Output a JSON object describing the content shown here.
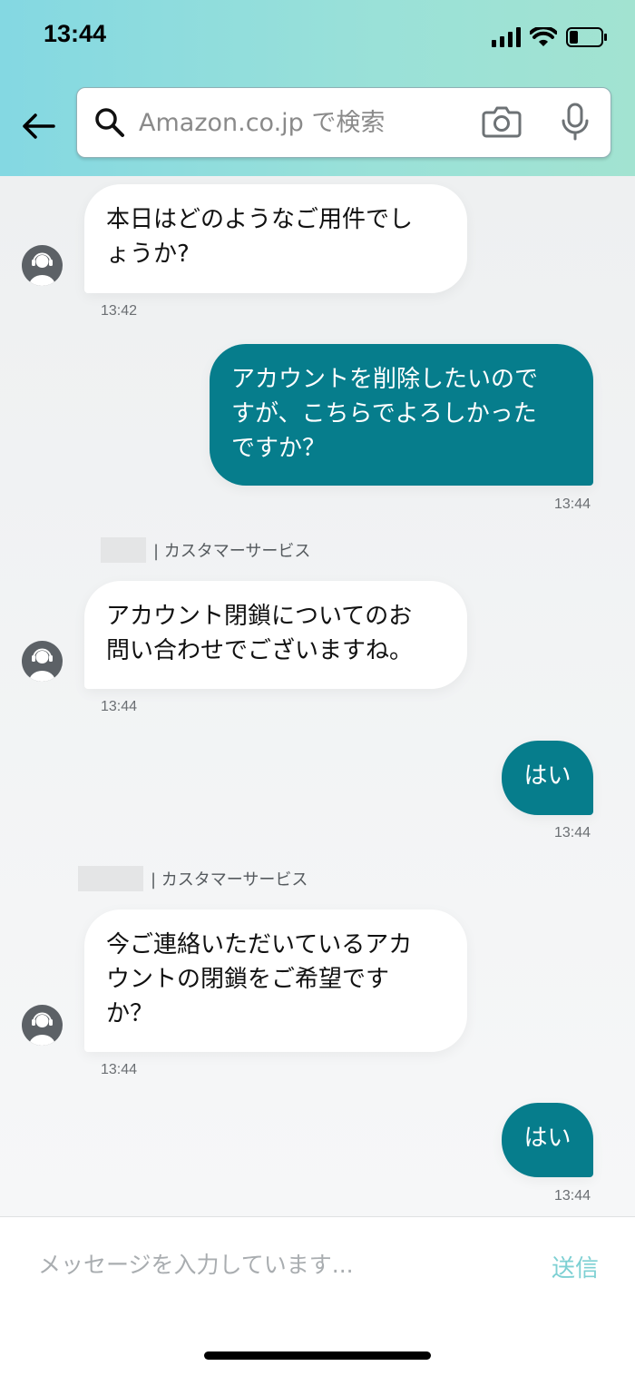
{
  "status_bar": {
    "time": "13:44"
  },
  "search": {
    "placeholder": "Amazon.co.jp で検索"
  },
  "messages": [
    {
      "from": "agent",
      "text": "本日はどのようなご用件でし\nょうか?",
      "time": "13:42"
    },
    {
      "from": "user",
      "text": "アカウントを削除したいので\nすが、こちらでよろしかった\nですか？",
      "time": "13:44"
    },
    {
      "from": "agent",
      "sender": "| カスタマーサービス",
      "text": "アカウント閉鎖についてのお\n問い合わせでございますね。",
      "time": "13:44"
    },
    {
      "from": "user",
      "text": "はい",
      "time": "13:44"
    },
    {
      "from": "agent",
      "sender": "| カスタマーサービス",
      "text": "今ご連絡いただいているアカ\nウントの閉鎖をご希望です\nか？",
      "time": "13:44"
    },
    {
      "from": "user",
      "text": "はい",
      "time": "13:44"
    }
  ],
  "composer": {
    "placeholder": "メッセージを入力しています...",
    "send_label": "送信"
  },
  "colors": {
    "user_bubble": "#067d8c",
    "send_button": "#7dd0d3"
  }
}
